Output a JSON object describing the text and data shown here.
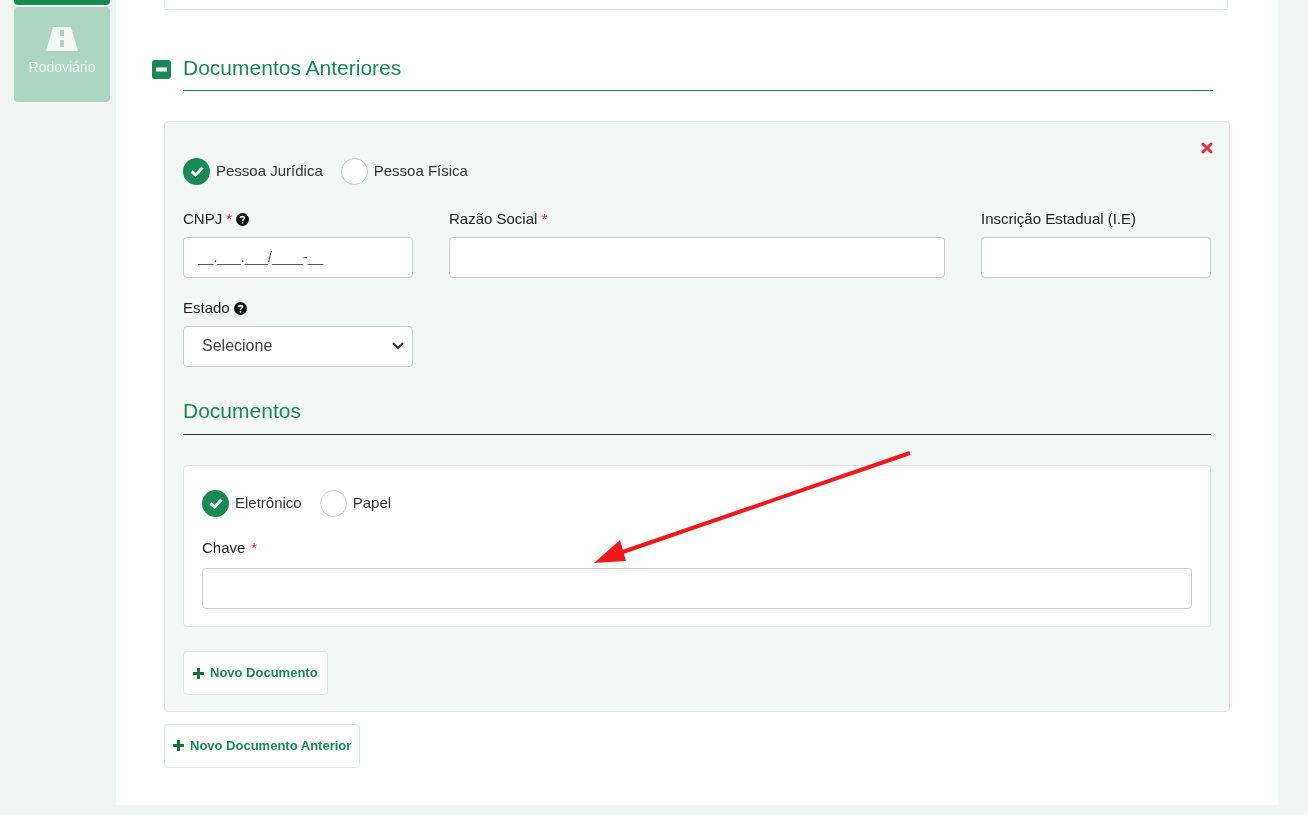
{
  "sidebar": {
    "items": [
      {
        "label": "Rodoviário",
        "selected": false
      }
    ]
  },
  "section": {
    "title": "Documentos Anteriores",
    "expanded": true
  },
  "entry": {
    "person_type": [
      {
        "label": "Pessoa Jurídica",
        "selected": true
      },
      {
        "label": "Pessoa Física",
        "selected": false
      }
    ],
    "fields": [
      {
        "kind": "text",
        "label": "CNPJ",
        "required_mark": "*",
        "help": true,
        "placeholder": "__.___.___/____-__"
      },
      {
        "kind": "text",
        "label": "Razão Social",
        "required_mark": "*",
        "help": false
      },
      {
        "kind": "text",
        "label": "Inscrição Estadual (I.E)",
        "help": false
      },
      {
        "kind": "select",
        "label": "Estado",
        "help": true,
        "value": "Selecione"
      }
    ],
    "documents": {
      "title": "Documentos",
      "doc_type": [
        {
          "label": "Eletrônico",
          "selected": true
        },
        {
          "label": "Papel",
          "selected": false
        }
      ],
      "key_field": {
        "label": "Chave",
        "required_mark": "*"
      }
    },
    "add_document_button": "Novo Documento"
  },
  "add_previous_document_button": "Novo Documento Anterior"
}
